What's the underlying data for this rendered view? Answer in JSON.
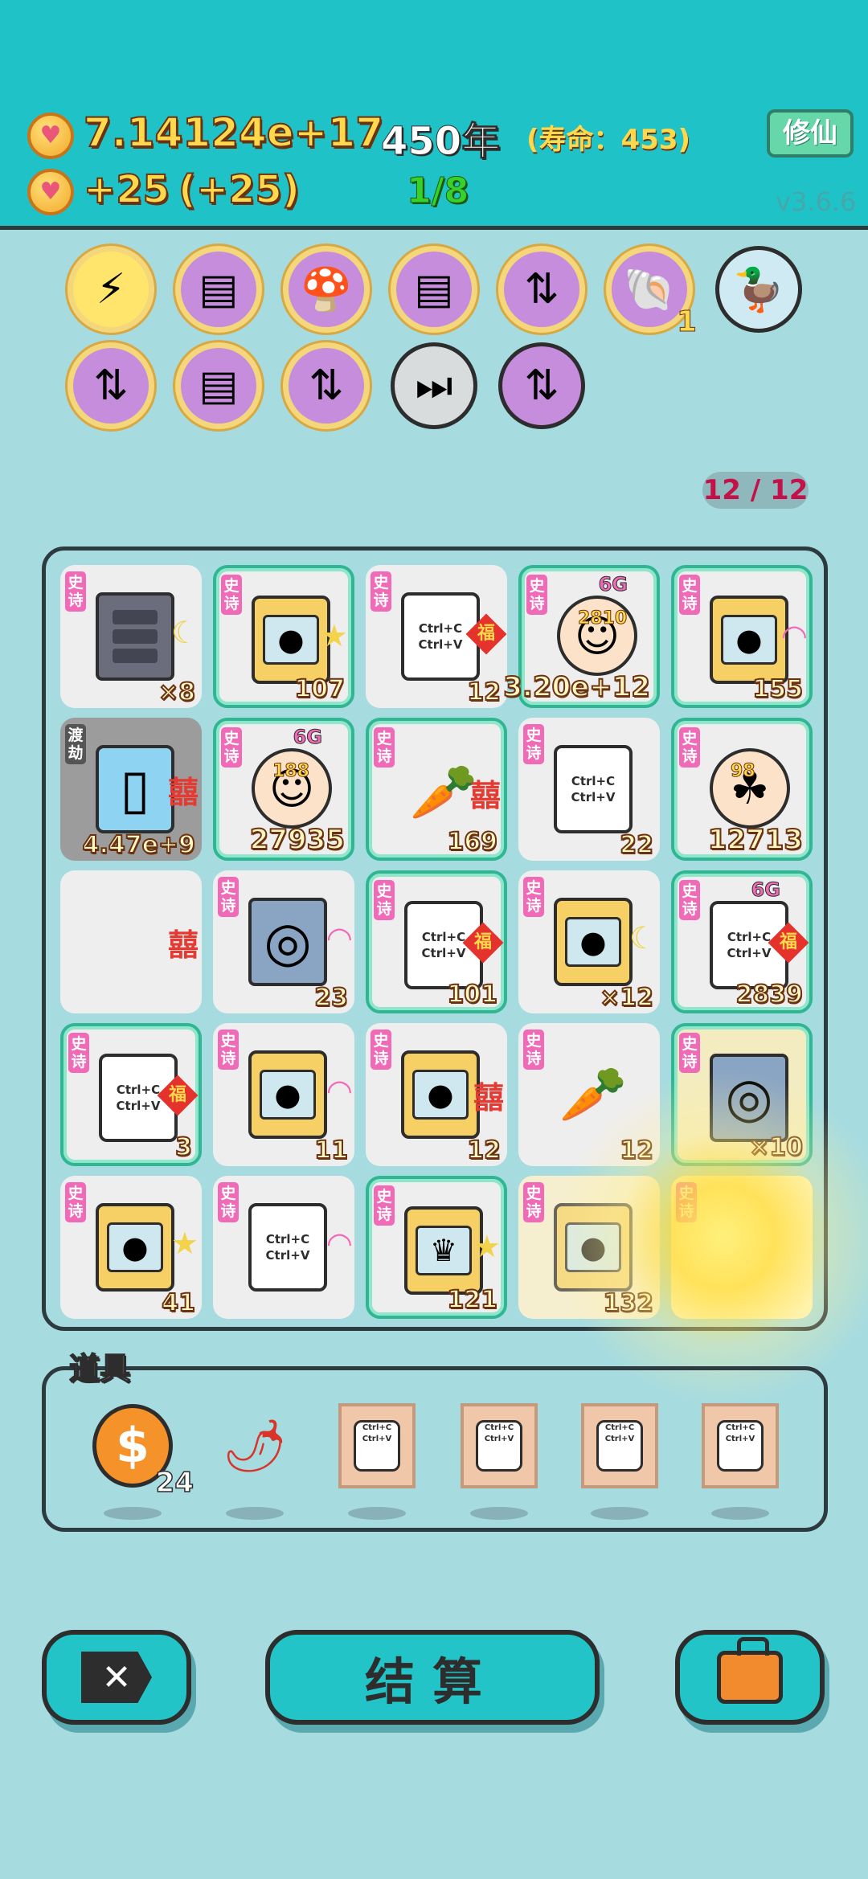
{
  "header": {
    "coins_total": "7.14124e+17",
    "coins_rate": "+25",
    "coins_rate_extra": "(+25)",
    "year": "450年",
    "lifespan": "(寿命：453)",
    "progress": "1/8",
    "xiuxian_label": "修仙",
    "version": "v3.6.6",
    "coin_icon": "heart-coin-icon"
  },
  "relics": [
    {
      "name": "lightning-fruit-icon",
      "glyph": "⚡",
      "count": ""
    },
    {
      "name": "pleated-skirt-icon",
      "glyph": "▤",
      "count": ""
    },
    {
      "name": "mushroom-cloud-icon",
      "glyph": "🍄",
      "count": ""
    },
    {
      "name": "pleated-skirt-icon",
      "glyph": "▤",
      "count": ""
    },
    {
      "name": "capsule-upgrade-icon",
      "glyph": "⇅",
      "count": ""
    },
    {
      "name": "seashell-icon",
      "glyph": "🐚",
      "count": "1"
    },
    {
      "name": "duck-pot-icon",
      "glyph": "🦆",
      "count": ""
    },
    {
      "name": "capsule-upgrade-icon",
      "glyph": "⇅",
      "count": ""
    },
    {
      "name": "pleated-skirt-icon",
      "glyph": "▤",
      "count": ""
    },
    {
      "name": "capsule-upgrade-icon",
      "glyph": "⇅",
      "count": ""
    },
    {
      "name": "skip-icon",
      "glyph": "⏭",
      "count": ""
    },
    {
      "name": "capsule-upgrade-icon",
      "glyph": "⇅",
      "count": ""
    }
  ],
  "slots": "12 / 12",
  "grid": {
    "tag_epic": "史诗",
    "tag_dujie": "渡劫",
    "ctrl_c": "Ctrl+C",
    "ctrl_v": "Ctrl+V",
    "fu": "福",
    "xi": "囍",
    "g6": "6G",
    "cells": [
      {
        "item": "server",
        "count": "×8"
      },
      {
        "item": "gacha-machine",
        "count": "107"
      },
      {
        "item": "copy-paste",
        "count": "12"
      },
      {
        "item": "face-6g",
        "mini": "2810",
        "count": "3.20e+12"
      },
      {
        "item": "gacha-machine",
        "count": "155"
      },
      {
        "item": "fridge",
        "count": "4.47e+9"
      },
      {
        "item": "face-6g",
        "mini": "188",
        "count": "27935"
      },
      {
        "item": "carrot",
        "count": "169"
      },
      {
        "item": "copy-paste",
        "count": "22"
      },
      {
        "item": "face-clover",
        "mini": "98",
        "count": "12713"
      },
      {
        "item": "empty-xi",
        "count": ""
      },
      {
        "item": "gpu",
        "count": "23"
      },
      {
        "item": "copy-paste",
        "count": "101"
      },
      {
        "item": "gacha-machine",
        "count": "×12"
      },
      {
        "item": "copy-paste-6g",
        "count": "2839"
      },
      {
        "item": "copy-paste-crown",
        "count": "3"
      },
      {
        "item": "gacha-machine",
        "count": "11"
      },
      {
        "item": "gacha-machine",
        "count": "12"
      },
      {
        "item": "carrot",
        "count": "12"
      },
      {
        "item": "gpu",
        "count": "×10"
      },
      {
        "item": "gacha-machine",
        "count": "41"
      },
      {
        "item": "copy-paste",
        "count": ""
      },
      {
        "item": "gacha-machine-crown",
        "count": "121"
      },
      {
        "item": "gacha-machine",
        "count": "132"
      },
      {
        "item": "exploding",
        "count": ""
      }
    ]
  },
  "props": {
    "label": "道具",
    "coin_count": "24",
    "items": [
      "dollar-coin-icon",
      "chili-pepper-icon",
      "copy-paste-frame-icon",
      "copy-paste-frame-icon",
      "copy-paste-frame-icon",
      "copy-paste-frame-icon"
    ]
  },
  "buttons": {
    "close_label": "✕",
    "settle_label": "结算",
    "bag_icon": "briefcase-icon"
  },
  "colors": {
    "header_bg": "#1fc3c7",
    "page_bg": "#a6dbe0",
    "epic_border": "#2fb692",
    "gold_text": "#ffd84b",
    "progress_green": "#38d12b"
  }
}
